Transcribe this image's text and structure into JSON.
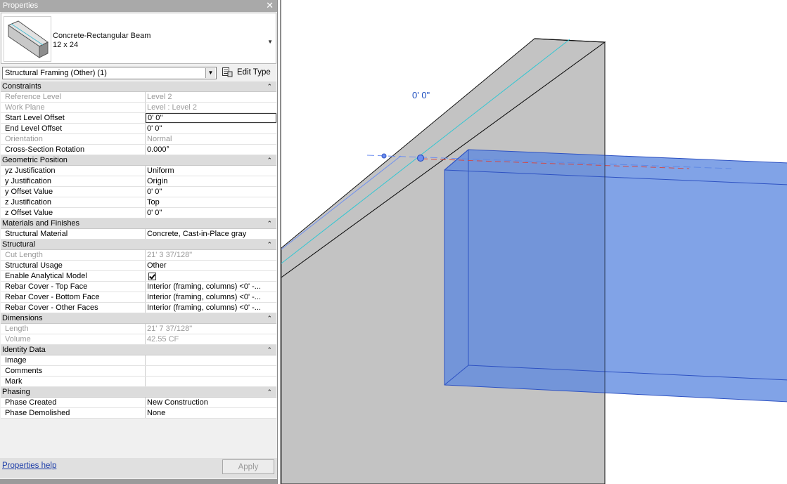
{
  "panel": {
    "title": "Properties",
    "close_glyph": "✕",
    "type_family": "Concrete-Rectangular Beam",
    "type_size": "12 x 24",
    "filter": "Structural Framing (Other) (1)",
    "edit_type": "Edit Type",
    "help": "Properties help",
    "apply": "Apply"
  },
  "groups": [
    {
      "name": "Constraints",
      "rows": [
        {
          "k": "Reference Level",
          "v": "Level 2",
          "disabled": true
        },
        {
          "k": "Work Plane",
          "v": "Level : Level 2",
          "disabled": true
        },
        {
          "k": "Start Level Offset",
          "v": "0'  0\"",
          "editing": true
        },
        {
          "k": "End Level Offset",
          "v": "0'  0\""
        },
        {
          "k": "Orientation",
          "v": "Normal",
          "disabled": true
        },
        {
          "k": "Cross-Section Rotation",
          "v": "0.000°"
        }
      ]
    },
    {
      "name": "Geometric Position",
      "rows": [
        {
          "k": "yz Justification",
          "v": "Uniform"
        },
        {
          "k": "y Justification",
          "v": "Origin"
        },
        {
          "k": "y Offset Value",
          "v": "0'  0\""
        },
        {
          "k": "z Justification",
          "v": "Top"
        },
        {
          "k": "z Offset Value",
          "v": "0'  0\""
        }
      ]
    },
    {
      "name": "Materials and Finishes",
      "rows": [
        {
          "k": "Structural Material",
          "v": "Concrete, Cast-in-Place gray"
        }
      ]
    },
    {
      "name": "Structural",
      "rows": [
        {
          "k": "Cut Length",
          "v": "21'  3 37/128\"",
          "disabled": true
        },
        {
          "k": "Structural Usage",
          "v": "Other"
        },
        {
          "k": "Enable Analytical Model",
          "v": "",
          "checkbox": true
        },
        {
          "k": "Rebar Cover - Top Face",
          "v": "Interior (framing, columns) <0' -..."
        },
        {
          "k": "Rebar Cover - Bottom Face",
          "v": "Interior (framing, columns) <0' -..."
        },
        {
          "k": "Rebar Cover - Other Faces",
          "v": "Interior (framing, columns) <0' -..."
        }
      ]
    },
    {
      "name": "Dimensions",
      "rows": [
        {
          "k": "Length",
          "v": "21'  7 37/128\"",
          "disabled": true
        },
        {
          "k": "Volume",
          "v": "42.55 CF",
          "disabled": true
        }
      ]
    },
    {
      "name": "Identity Data",
      "rows": [
        {
          "k": "Image",
          "v": ""
        },
        {
          "k": "Comments",
          "v": ""
        },
        {
          "k": "Mark",
          "v": ""
        }
      ]
    },
    {
      "name": "Phasing",
      "rows": [
        {
          "k": "Phase Created",
          "v": "New Construction"
        },
        {
          "k": "Phase Demolished",
          "v": "None"
        }
      ]
    }
  ],
  "viewport": {
    "dimension_label": "0'  0\"",
    "colors": {
      "selection": "#5a86e0",
      "concrete": "#c3c3c3",
      "dimension": "#1f4fbf"
    }
  }
}
